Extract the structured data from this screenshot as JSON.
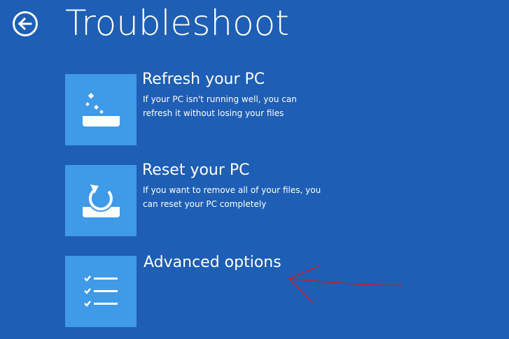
{
  "header": {
    "title": "Troubleshoot",
    "back_icon": "back-arrow-circle-icon"
  },
  "options": [
    {
      "title": "Refresh your PC",
      "description": "If your PC isn't running well, you can refresh it without losing your files",
      "icon": "refresh-pc-icon"
    },
    {
      "title": "Reset your PC",
      "description": "If you want to remove all of your files, you can reset your PC completely",
      "icon": "reset-pc-icon"
    },
    {
      "title": "Advanced options",
      "icon": "checklist-icon"
    }
  ],
  "annotation": {
    "icon": "red-arrow-annotation"
  },
  "colors": {
    "background": "#1e5eb4",
    "tile": "#3f9ae8",
    "text": "#ffffff",
    "annotation": "#c0202c"
  }
}
